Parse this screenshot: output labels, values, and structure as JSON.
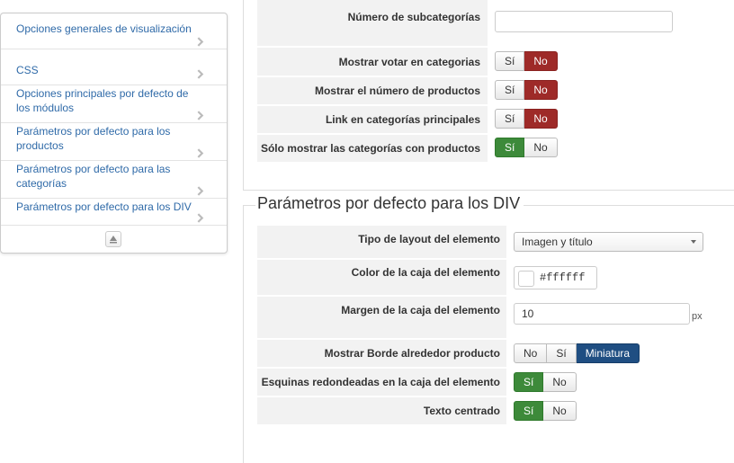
{
  "sidebar": {
    "items": [
      {
        "label": "Opciones generales de visualización"
      },
      {
        "label": "CSS"
      },
      {
        "label": "Opciones principales por defecto de los módulos"
      },
      {
        "label": "Parámetros por defecto para los productos"
      },
      {
        "label": "Parámetros por defecto para las categorías"
      },
      {
        "label": "Parámetros por defecto para los DIV"
      }
    ]
  },
  "categories_section": {
    "rows": [
      {
        "label": "Número de subcategorías",
        "type": "text",
        "value": ""
      },
      {
        "label": "Mostrar votar en categorias",
        "type": "toggle",
        "options": [
          "Sí",
          "No"
        ],
        "selected": "No"
      },
      {
        "label": "Mostrar el número de productos",
        "type": "toggle",
        "options": [
          "Sí",
          "No"
        ],
        "selected": "No"
      },
      {
        "label": "Link en categorías principales",
        "type": "toggle",
        "options": [
          "Sí",
          "No"
        ],
        "selected": "No"
      },
      {
        "label": "Sólo mostrar las categorías con productos",
        "type": "toggle",
        "options": [
          "Sí",
          "No"
        ],
        "selected": "Sí"
      }
    ]
  },
  "div_section": {
    "title": "Parámetros por defecto para los DIV",
    "rows": [
      {
        "label": "Tipo de layout del elemento",
        "type": "select",
        "value": "Imagen y título"
      },
      {
        "label": "Color de la caja del elemento",
        "type": "color",
        "value": "#ffffff"
      },
      {
        "label": "Margen de la caja del elemento",
        "type": "text",
        "value": "10",
        "unit": "px"
      },
      {
        "label": "Mostrar Borde alrededor producto",
        "type": "toggle",
        "options": [
          "No",
          "Sí",
          "Miniatura"
        ],
        "selected": "Miniatura"
      },
      {
        "label": "Esquinas redondeadas en la caja del elemento",
        "type": "toggle",
        "options": [
          "Sí",
          "No"
        ],
        "selected": "Sí"
      },
      {
        "label": "Texto centrado",
        "type": "toggle",
        "options": [
          "Sí",
          "No"
        ],
        "selected": "Sí"
      }
    ]
  },
  "colors": {
    "link": "#2f6aa8",
    "no_active": "#9e2a28",
    "yes_active": "#3d8a3a",
    "thumbnail_active": "#1f4e82",
    "row_bg": "#f2f2f2"
  }
}
